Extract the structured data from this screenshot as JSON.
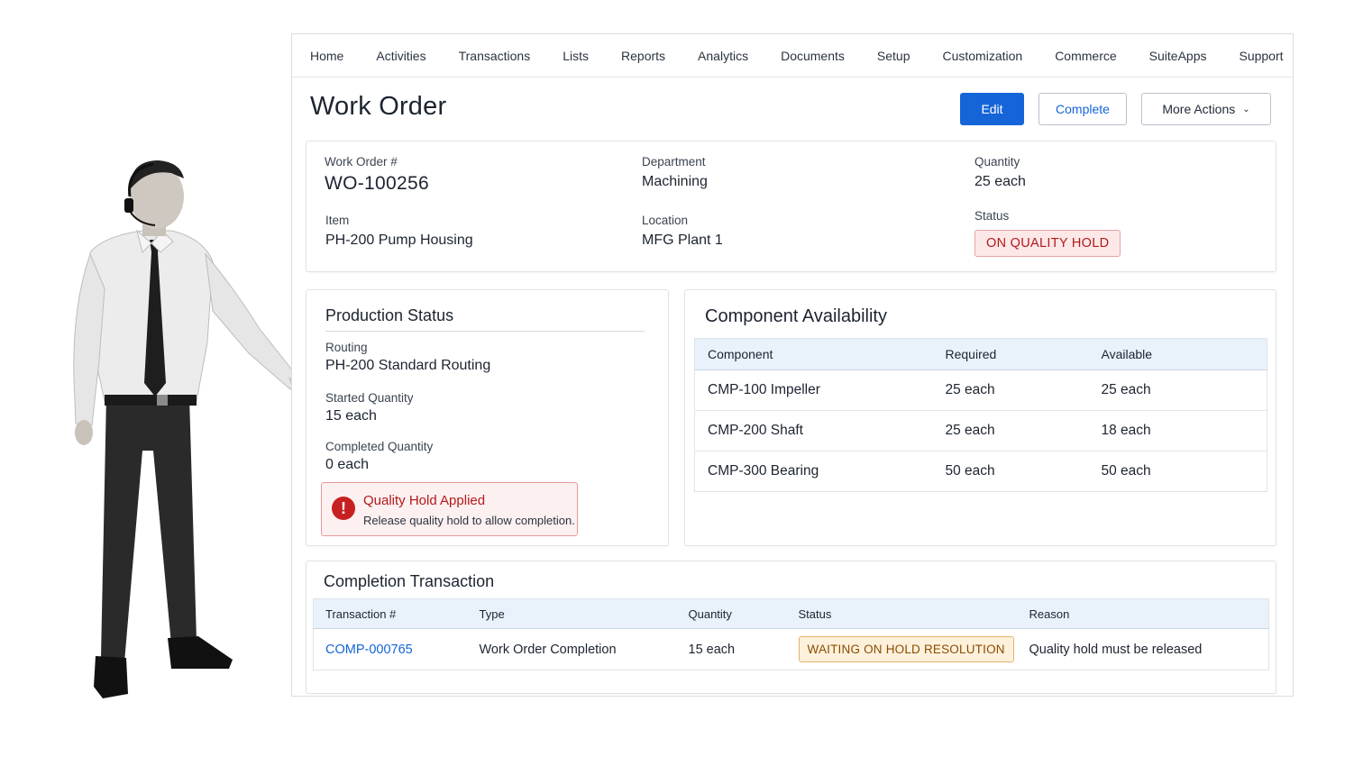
{
  "nav": [
    "Home",
    "Activities",
    "Transactions",
    "Lists",
    "Reports",
    "Analytics",
    "Documents",
    "Setup",
    "Customization",
    "Commerce",
    "SuiteApps",
    "Support"
  ],
  "page_title": "Work Order",
  "actions": {
    "edit": "Edit",
    "complete": "Complete",
    "more": "More Actions"
  },
  "summary": {
    "work_order_label": "Work Order #",
    "work_order": "WO-100256",
    "department_label": "Department",
    "department": "Machining",
    "quantity_label": "Quantity",
    "quantity": "25 each",
    "item_label": "Item",
    "item": "PH-200 Pump Housing",
    "location_label": "Location",
    "location": "MFG Plant 1",
    "status_label": "Status",
    "status": "ON QUALITY HOLD"
  },
  "production": {
    "title": "Production Status",
    "routing_label": "Routing",
    "routing": "PH-200 Standard Routing",
    "started_label": "Started Quantity",
    "started": "15 each",
    "completed_label": "Completed Quantity",
    "completed": "0 each",
    "alert_title": "Quality Hold Applied",
    "alert_text": "Release quality hold to allow completion."
  },
  "components": {
    "title": "Component Availability",
    "headers": [
      "Component",
      "Required",
      "Available"
    ],
    "rows": [
      {
        "component": "CMP-100 Impeller",
        "required": "25 each",
        "available": "25 each"
      },
      {
        "component": "CMP-200 Shaft",
        "required": "25 each",
        "available": "18 each"
      },
      {
        "component": "CMP-300 Bearing",
        "required": "50 each",
        "available": "50 each"
      }
    ]
  },
  "transaction": {
    "title": "Completion Transaction",
    "headers": [
      "Transaction #",
      "Type",
      "Quantity",
      "Status",
      "Reason"
    ],
    "row": {
      "id": "COMP-000765",
      "type": "Work Order Completion",
      "quantity": "15 each",
      "status": "WAITING ON HOLD RESOLUTION",
      "reason": "Quality hold must be released"
    }
  },
  "colors": {
    "primary": "#1565d8",
    "danger": "#c22424",
    "success": "#237a2e",
    "warning": "#8a4b00"
  }
}
